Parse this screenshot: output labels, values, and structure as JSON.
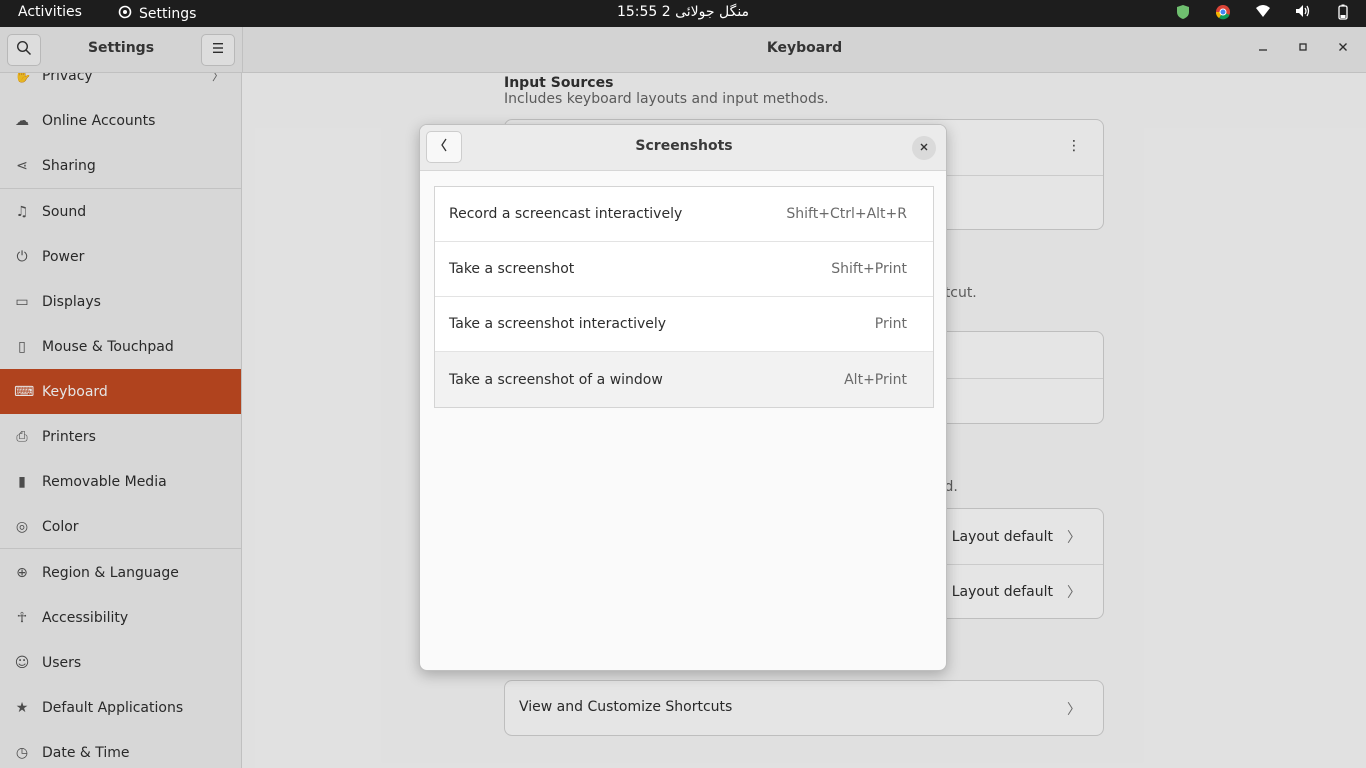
{
  "topbar": {
    "activities": "Activities",
    "app_name": "Settings",
    "clock": "15:55  منگل جولائی 2"
  },
  "window": {
    "sidebar_title": "Settings",
    "main_title": "Keyboard"
  },
  "sidebar": {
    "items": [
      {
        "label": "Privacy",
        "icon": "hand-icon"
      },
      {
        "label": "Online Accounts",
        "icon": "cloud-icon"
      },
      {
        "label": "Sharing",
        "icon": "share-icon"
      },
      {
        "label": "Sound",
        "icon": "music-note-icon"
      },
      {
        "label": "Power",
        "icon": "power-icon"
      },
      {
        "label": "Displays",
        "icon": "display-icon"
      },
      {
        "label": "Mouse & Touchpad",
        "icon": "mouse-icon"
      },
      {
        "label": "Keyboard",
        "icon": "keyboard-icon"
      },
      {
        "label": "Printers",
        "icon": "printer-icon"
      },
      {
        "label": "Removable Media",
        "icon": "removable-media-icon"
      },
      {
        "label": "Color",
        "icon": "color-icon"
      },
      {
        "label": "Region & Language",
        "icon": "globe-icon"
      },
      {
        "label": "Accessibility",
        "icon": "accessibility-icon"
      },
      {
        "label": "Users",
        "icon": "users-icon"
      },
      {
        "label": "Default Applications",
        "icon": "star-icon"
      },
      {
        "label": "Date & Time",
        "icon": "clock-icon"
      }
    ]
  },
  "main": {
    "input_sources_title": "Input Sources",
    "input_sources_desc": "Includes keyboard layouts and input methods.",
    "partial_desc_1": "rtcut.",
    "partial_desc_2": "rd.",
    "layout_default_1": "Layout default",
    "layout_default_2": "Layout default",
    "view_shortcuts": "View and Customize Shortcuts"
  },
  "dialog": {
    "title": "Screenshots",
    "shortcuts": [
      {
        "name": "Record a screencast interactively",
        "accel": "Shift+Ctrl+Alt+R"
      },
      {
        "name": "Take a screenshot",
        "accel": "Shift+Print"
      },
      {
        "name": "Take a screenshot interactively",
        "accel": "Print"
      },
      {
        "name": "Take a screenshot of a window",
        "accel": "Alt+Print"
      }
    ]
  },
  "colors": {
    "accent": "#c54b22"
  }
}
